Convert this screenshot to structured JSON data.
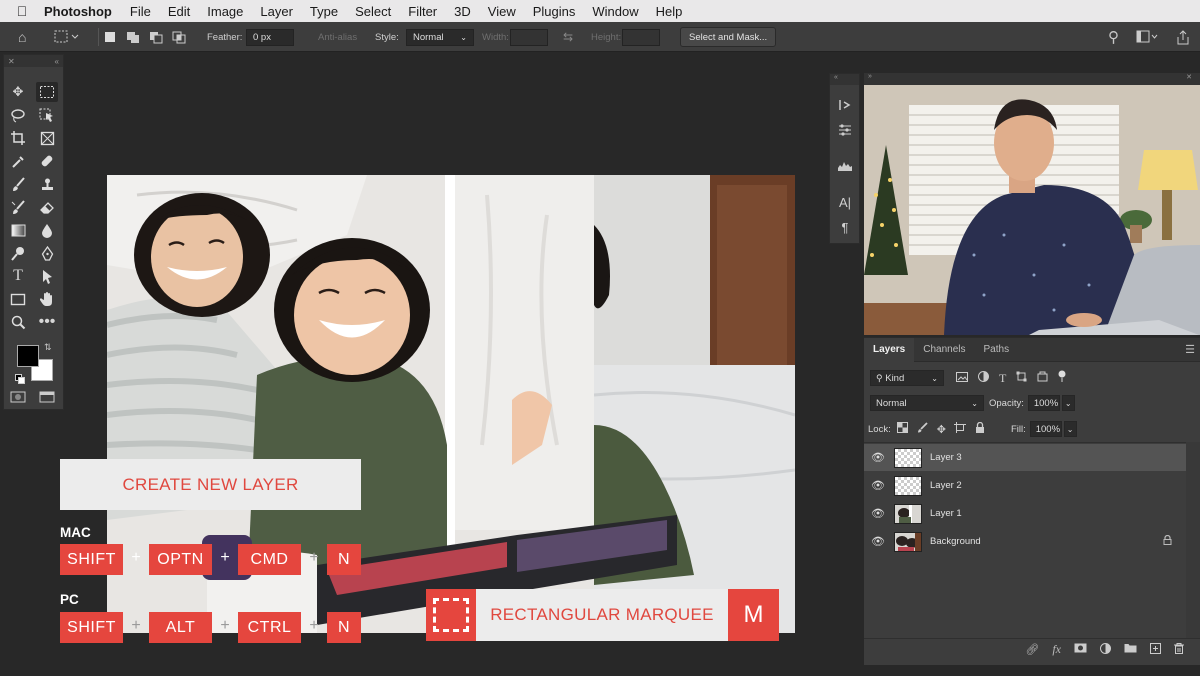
{
  "menubar": {
    "app_name": "Photoshop",
    "items": [
      "File",
      "Edit",
      "Image",
      "Layer",
      "Type",
      "Select",
      "Filter",
      "3D",
      "View",
      "Plugins",
      "Window",
      "Help"
    ]
  },
  "options_bar": {
    "feather_label": "Feather:",
    "feather_value": "0 px",
    "antialias_label": "Anti-alias",
    "style_label": "Style:",
    "style_value": "Normal",
    "width_label": "Width:",
    "height_label": "Height:",
    "select_mask_label": "Select and Mask..."
  },
  "overlay": {
    "callout": "CREATE NEW LAYER",
    "mac_label": "MAC",
    "mac_keys": [
      "SHIFT",
      "OPTN",
      "CMD",
      "N"
    ],
    "pc_label": "PC",
    "pc_keys": [
      "SHIFT",
      "ALT",
      "CTRL",
      "N"
    ],
    "plus": "+",
    "tool_name": "RECTANGULAR MARQUEE",
    "tool_key": "M"
  },
  "layers_panel": {
    "tabs": [
      "Layers",
      "Channels",
      "Paths"
    ],
    "filter_value": "Kind",
    "blend_mode": "Normal",
    "opacity_label": "Opacity:",
    "opacity_value": "100%",
    "lock_label": "Lock:",
    "fill_label": "Fill:",
    "fill_value": "100%",
    "layers": [
      {
        "name": "Layer 3",
        "active": true
      },
      {
        "name": "Layer 2",
        "active": false
      },
      {
        "name": "Layer 1",
        "active": false
      },
      {
        "name": "Background",
        "active": false,
        "locked": true
      }
    ]
  },
  "colors": {
    "accent_red": "#e5463e",
    "panel_bg": "#3d3d3d",
    "canvas_bg": "#282828"
  }
}
